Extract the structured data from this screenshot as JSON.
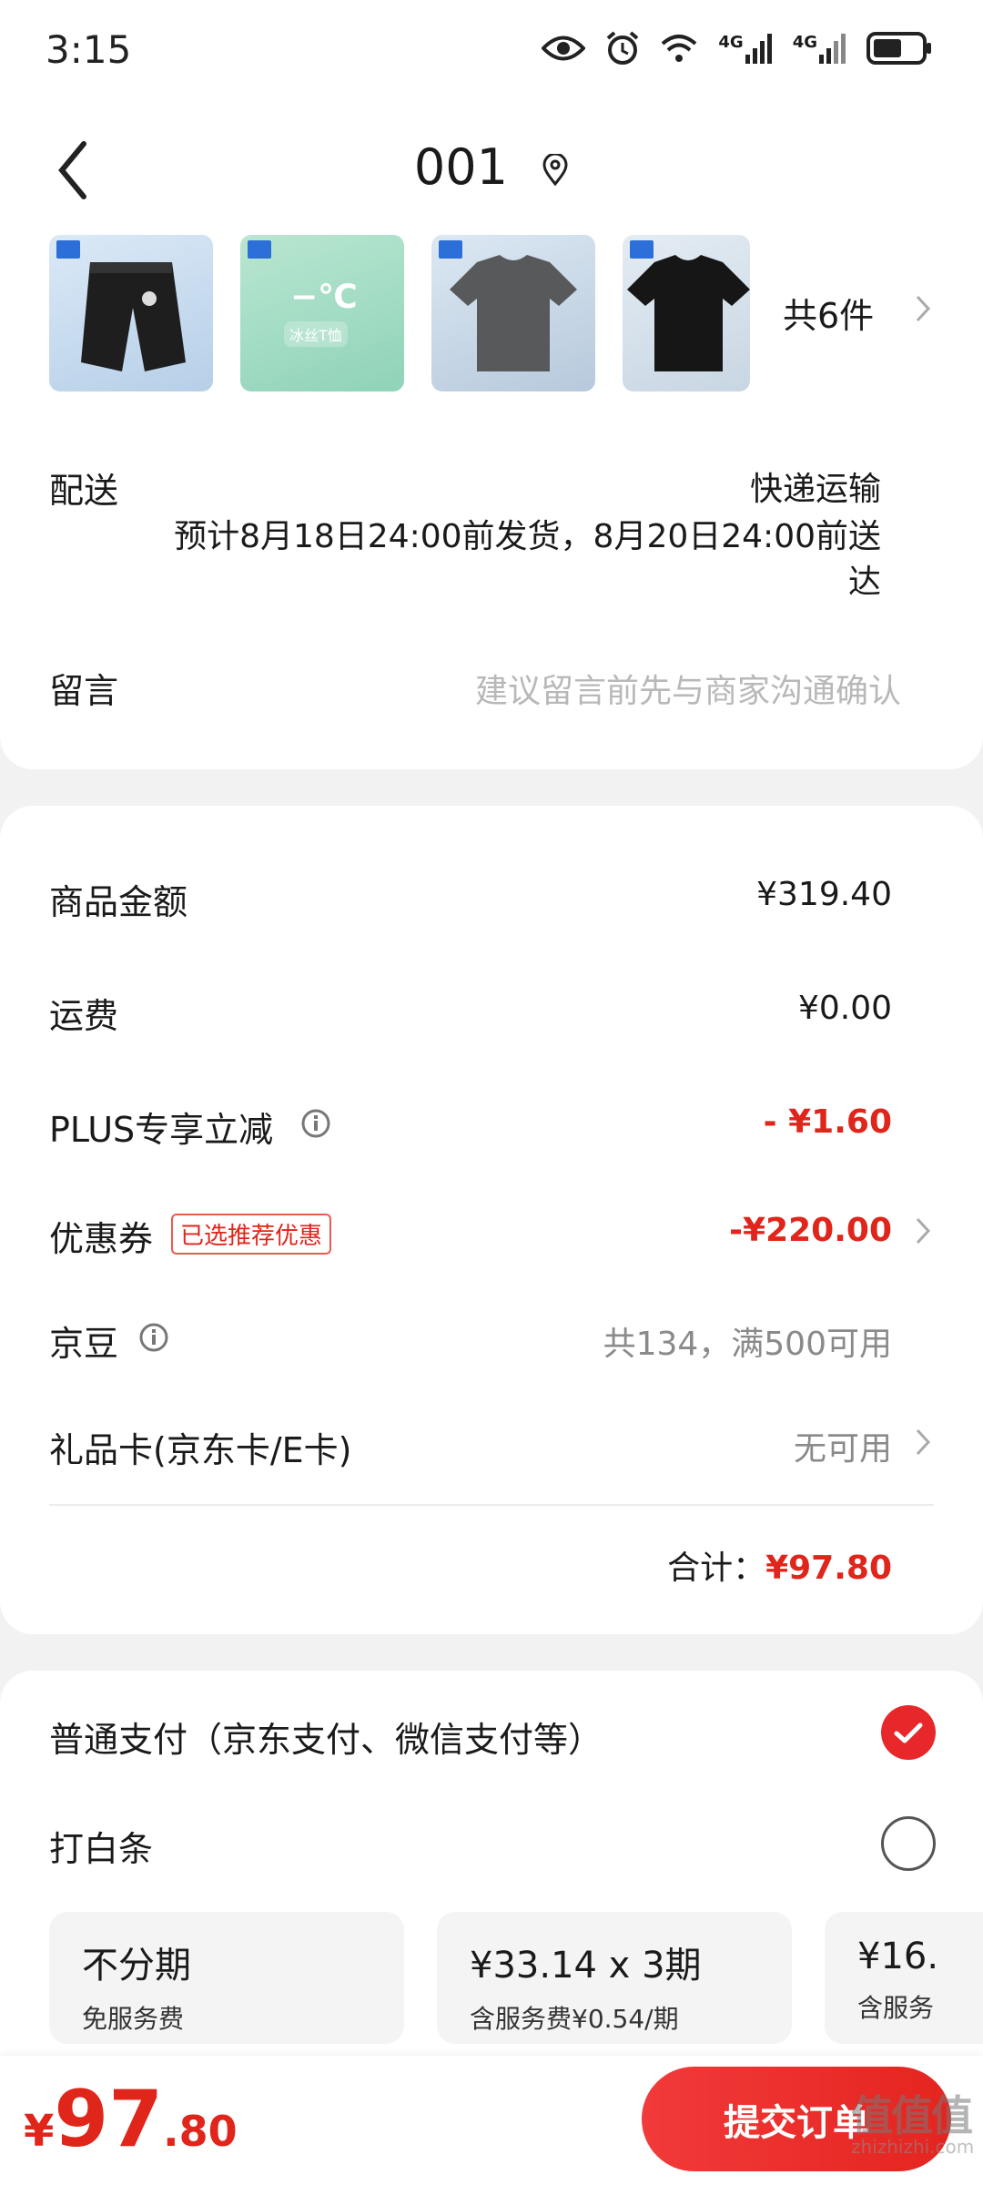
{
  "status_bar": {
    "time": "3:15",
    "icons": [
      "eye-icon",
      "alarm-icon",
      "wifi-icon",
      "signal-4g-icon",
      "signal-4g-icon",
      "battery-icon"
    ],
    "network_labels": [
      "4G",
      "4G"
    ]
  },
  "header": {
    "address": "001"
  },
  "products": {
    "thumb_labels": [
      "冰丝T恤"
    ],
    "count": "共6件"
  },
  "delivery": {
    "label": "配送",
    "method": "快递运输",
    "estimate": "预计8月18日24:00前发货，8月20日24:00前送达"
  },
  "note": {
    "label": "留言",
    "placeholder": "建议留言前先与商家沟通确认"
  },
  "price": {
    "goods_label": "商品金额",
    "goods_value": "¥319.40",
    "shipping_label": "运费",
    "shipping_value": "¥0.00",
    "plus_label": "PLUS专享立减",
    "plus_value": "- ¥1.60",
    "coupon_label": "优惠券",
    "coupon_tag": "已选推荐优惠",
    "coupon_value": "-¥220.00",
    "jingdou_label": "京豆",
    "jingdou_value": "共134，满500可用",
    "giftcard_label": "礼品卡(京东卡/E卡)",
    "giftcard_value": "无可用",
    "total_label": "合计：",
    "total_value": "¥97.80"
  },
  "payment": {
    "normal_label": "普通支付（京东支付、微信支付等）",
    "baitiao_label": "打白条",
    "plans": [
      {
        "title": "不分期",
        "sub": "免服务费"
      },
      {
        "title": "¥33.14 x 3期",
        "sub": "含服务费¥0.54/期"
      },
      {
        "title": "¥16.",
        "sub": "含服务"
      }
    ]
  },
  "bottom": {
    "currency": "¥",
    "integer": "97",
    "decimal": ".80",
    "submit_label": "提交订单",
    "watermark": "值值值",
    "watermark_sub": "zhizhizhi.com"
  },
  "colors": {
    "accent_red": "#e0251b",
    "submit_gradient": [
      "#f23a3a",
      "#e4241f"
    ],
    "background": "#f2f2f2"
  }
}
